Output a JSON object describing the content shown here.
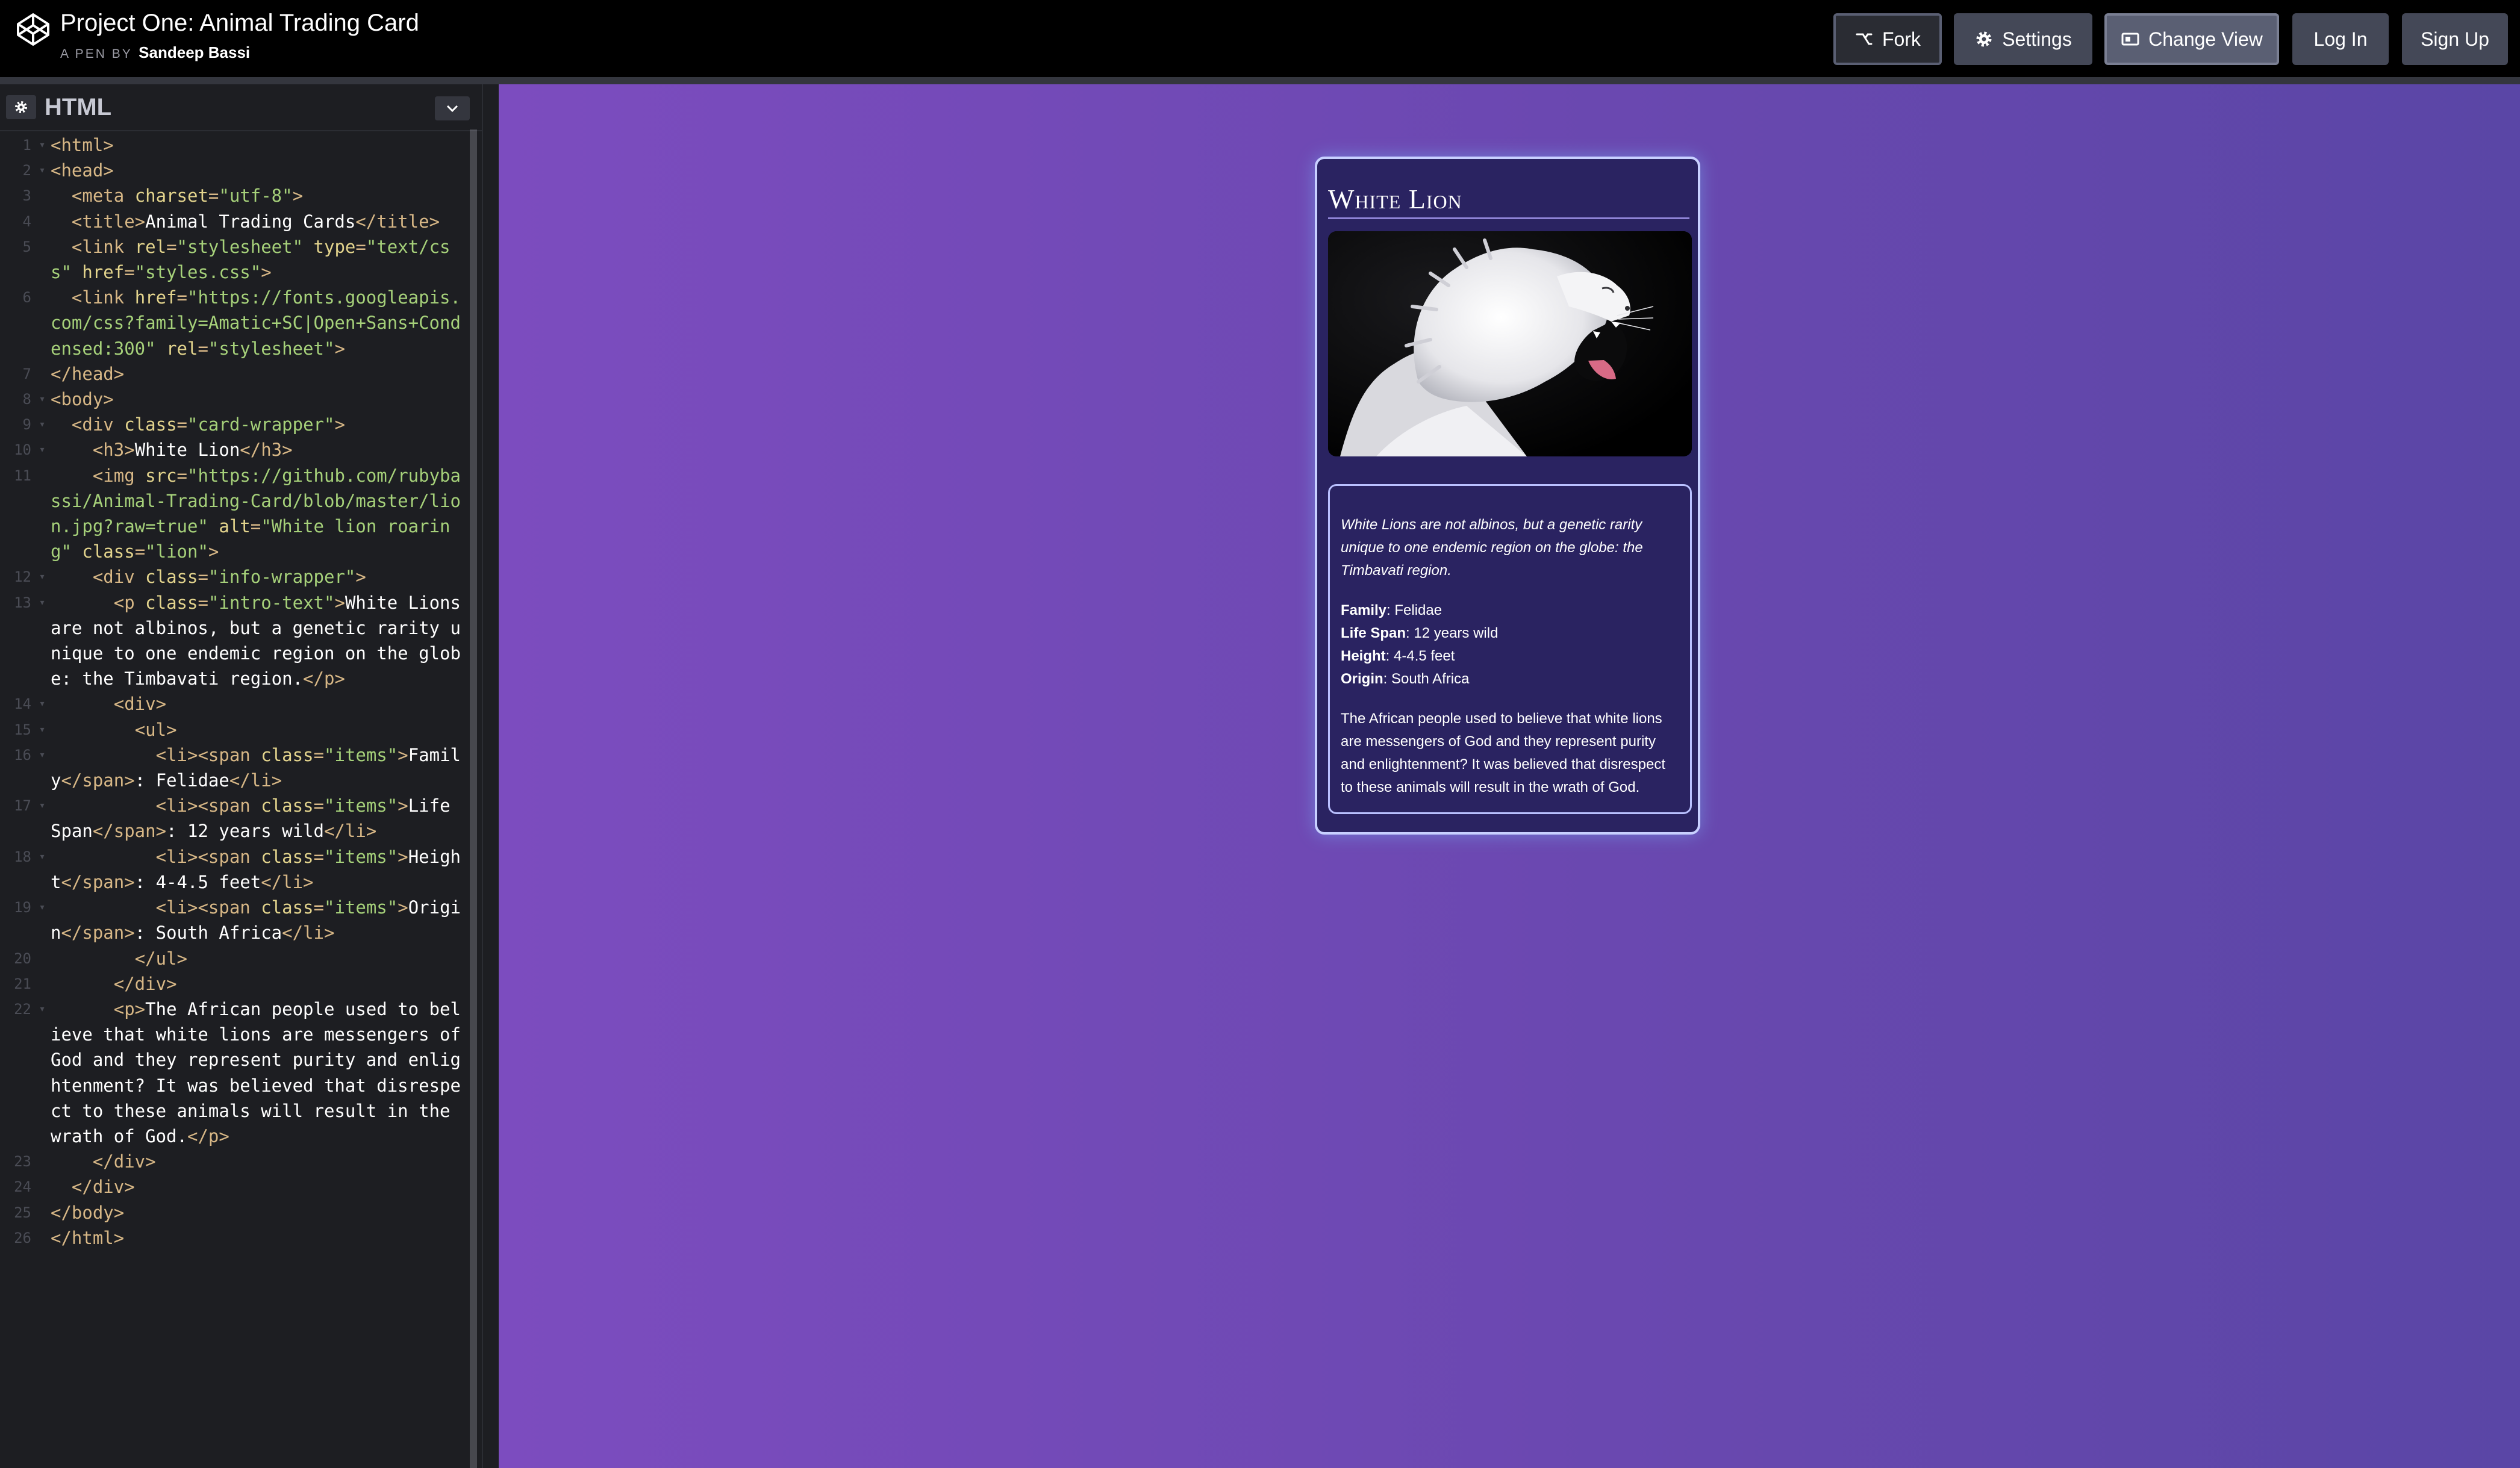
{
  "header": {
    "title": "Project One: Animal Trading Card",
    "byline_prefix": "A PEN BY",
    "author": "Sandeep Bassi",
    "buttons": {
      "fork": "Fork",
      "settings": "Settings",
      "change_view": "Change View",
      "login": "Log In",
      "signup": "Sign Up"
    },
    "icons": [
      "codepen-logo-icon",
      "fork-icon",
      "gear-icon",
      "layout-icon"
    ]
  },
  "editor": {
    "language": "HTML",
    "lines": [
      {
        "n": "1",
        "fold": true,
        "parts": [
          [
            "tag",
            "<html>"
          ]
        ]
      },
      {
        "n": "2",
        "fold": true,
        "parts": [
          [
            "tag",
            "<head>"
          ]
        ]
      },
      {
        "n": "3",
        "fold": false,
        "parts": [
          [
            "txt",
            "  "
          ],
          [
            "tag",
            "<meta "
          ],
          [
            "attr",
            "charset"
          ],
          [
            "tag",
            "="
          ],
          [
            "str",
            "\"utf-8\""
          ],
          [
            "tag",
            ">"
          ]
        ]
      },
      {
        "n": "4",
        "fold": false,
        "parts": [
          [
            "txt",
            "  "
          ],
          [
            "tag",
            "<title>"
          ],
          [
            "txt",
            "Animal Trading Cards"
          ],
          [
            "tag",
            "</title>"
          ]
        ]
      },
      {
        "n": "5",
        "fold": false,
        "parts": [
          [
            "txt",
            "  "
          ],
          [
            "tag",
            "<link "
          ],
          [
            "attr",
            "rel"
          ],
          [
            "tag",
            "="
          ],
          [
            "str",
            "\"stylesheet\""
          ],
          [
            "attr",
            " type"
          ],
          [
            "tag",
            "="
          ],
          [
            "str",
            "\"text/css\""
          ],
          [
            "attr",
            " href"
          ],
          [
            "tag",
            "="
          ],
          [
            "str",
            "\"styles.css\""
          ],
          [
            "tag",
            ">"
          ]
        ]
      },
      {
        "n": "6",
        "fold": false,
        "parts": [
          [
            "txt",
            "  "
          ],
          [
            "tag",
            "<link "
          ],
          [
            "attr",
            "href"
          ],
          [
            "tag",
            "="
          ],
          [
            "str",
            "\"https://fonts.googleapis.com/css?family=Amatic+SC|Open+Sans+Condensed:300\""
          ],
          [
            "attr",
            " rel"
          ],
          [
            "tag",
            "="
          ],
          [
            "str",
            "\"stylesheet\""
          ],
          [
            "tag",
            ">"
          ]
        ]
      },
      {
        "n": "7",
        "fold": false,
        "parts": [
          [
            "tag",
            "</head>"
          ]
        ]
      },
      {
        "n": "8",
        "fold": true,
        "parts": [
          [
            "tag",
            "<body>"
          ]
        ]
      },
      {
        "n": "9",
        "fold": true,
        "parts": [
          [
            "txt",
            "  "
          ],
          [
            "tag",
            "<div "
          ],
          [
            "attr",
            "class"
          ],
          [
            "tag",
            "="
          ],
          [
            "str",
            "\"card-wrapper\""
          ],
          [
            "tag",
            ">"
          ]
        ]
      },
      {
        "n": "10",
        "fold": true,
        "parts": [
          [
            "txt",
            "    "
          ],
          [
            "tag",
            "<h3>"
          ],
          [
            "txt",
            "White Lion"
          ],
          [
            "tag",
            "</h3>"
          ]
        ]
      },
      {
        "n": "11",
        "fold": false,
        "parts": [
          [
            "txt",
            "    "
          ],
          [
            "tag",
            "<img "
          ],
          [
            "attr",
            "src"
          ],
          [
            "tag",
            "="
          ],
          [
            "str",
            "\"https://github.com/rubybassi/Animal-Trading-Card/blob/master/lion.jpg?raw=true\""
          ],
          [
            "attr",
            " alt"
          ],
          [
            "tag",
            "="
          ],
          [
            "str",
            "\"White lion roaring\""
          ],
          [
            "attr",
            " class"
          ],
          [
            "tag",
            "="
          ],
          [
            "str",
            "\"lion\""
          ],
          [
            "tag",
            ">"
          ]
        ]
      },
      {
        "n": "12",
        "fold": true,
        "parts": [
          [
            "txt",
            "    "
          ],
          [
            "tag",
            "<div "
          ],
          [
            "attr",
            "class"
          ],
          [
            "tag",
            "="
          ],
          [
            "str",
            "\"info-wrapper\""
          ],
          [
            "tag",
            ">"
          ]
        ]
      },
      {
        "n": "13",
        "fold": true,
        "parts": [
          [
            "txt",
            "      "
          ],
          [
            "tag",
            "<p "
          ],
          [
            "attr",
            "class"
          ],
          [
            "tag",
            "="
          ],
          [
            "str",
            "\"intro-text\""
          ],
          [
            "tag",
            ">"
          ],
          [
            "txt",
            "White Lions are not albinos, but a genetic rarity unique to one endemic region on the globe: the Timbavati region."
          ],
          [
            "tag",
            "</p>"
          ]
        ]
      },
      {
        "n": "14",
        "fold": true,
        "parts": [
          [
            "txt",
            "      "
          ],
          [
            "tag",
            "<div>"
          ]
        ]
      },
      {
        "n": "15",
        "fold": true,
        "parts": [
          [
            "txt",
            "        "
          ],
          [
            "tag",
            "<ul>"
          ]
        ]
      },
      {
        "n": "16",
        "fold": true,
        "parts": [
          [
            "txt",
            "          "
          ],
          [
            "tag",
            "<li><span "
          ],
          [
            "attr",
            "class"
          ],
          [
            "tag",
            "="
          ],
          [
            "str",
            "\"items\""
          ],
          [
            "tag",
            ">"
          ],
          [
            "txt",
            "Family"
          ],
          [
            "tag",
            "</span>"
          ],
          [
            "txt",
            ": Felidae"
          ],
          [
            "tag",
            "</li>"
          ]
        ]
      },
      {
        "n": "17",
        "fold": true,
        "parts": [
          [
            "txt",
            "          "
          ],
          [
            "tag",
            "<li><span "
          ],
          [
            "attr",
            "class"
          ],
          [
            "tag",
            "="
          ],
          [
            "str",
            "\"items\""
          ],
          [
            "tag",
            ">"
          ],
          [
            "txt",
            "Life Span"
          ],
          [
            "tag",
            "</span>"
          ],
          [
            "txt",
            ": 12 years wild"
          ],
          [
            "tag",
            "</li>"
          ]
        ]
      },
      {
        "n": "18",
        "fold": true,
        "parts": [
          [
            "txt",
            "          "
          ],
          [
            "tag",
            "<li><span "
          ],
          [
            "attr",
            "class"
          ],
          [
            "tag",
            "="
          ],
          [
            "str",
            "\"items\""
          ],
          [
            "tag",
            ">"
          ],
          [
            "txt",
            "Height"
          ],
          [
            "tag",
            "</span>"
          ],
          [
            "txt",
            ": 4-4.5 feet"
          ],
          [
            "tag",
            "</li>"
          ]
        ]
      },
      {
        "n": "19",
        "fold": true,
        "parts": [
          [
            "txt",
            "          "
          ],
          [
            "tag",
            "<li><span "
          ],
          [
            "attr",
            "class"
          ],
          [
            "tag",
            "="
          ],
          [
            "str",
            "\"items\""
          ],
          [
            "tag",
            ">"
          ],
          [
            "txt",
            "Origin"
          ],
          [
            "tag",
            "</span>"
          ],
          [
            "txt",
            ": South Africa"
          ],
          [
            "tag",
            "</li>"
          ]
        ]
      },
      {
        "n": "20",
        "fold": false,
        "parts": [
          [
            "txt",
            "        "
          ],
          [
            "tag",
            "</ul>"
          ]
        ]
      },
      {
        "n": "21",
        "fold": false,
        "parts": [
          [
            "txt",
            "      "
          ],
          [
            "tag",
            "</div>"
          ]
        ]
      },
      {
        "n": "22",
        "fold": true,
        "parts": [
          [
            "txt",
            "      "
          ],
          [
            "tag",
            "<p>"
          ],
          [
            "txt",
            "The African people used to believe that white lions are messengers of God and they represent purity and enlightenment? It was believed that disrespect to these animals will result in the wrath of God."
          ],
          [
            "tag",
            "</p>"
          ]
        ]
      },
      {
        "n": "23",
        "fold": false,
        "parts": [
          [
            "txt",
            "    "
          ],
          [
            "tag",
            "</div>"
          ]
        ]
      },
      {
        "n": "24",
        "fold": false,
        "parts": [
          [
            "txt",
            "  "
          ],
          [
            "tag",
            "</div>"
          ]
        ]
      },
      {
        "n": "25",
        "fold": false,
        "parts": [
          [
            "tag",
            "</body>"
          ]
        ]
      },
      {
        "n": "26",
        "fold": false,
        "parts": [
          [
            "tag",
            "</html>"
          ]
        ]
      }
    ]
  },
  "card": {
    "title": "White Lion",
    "image_alt": "White lion roaring",
    "intro": "White Lions are not albinos, but a genetic rarity unique to one endemic region on the globe: the Timbavati region.",
    "facts": [
      {
        "label": "Family",
        "value": ": Felidae"
      },
      {
        "label": "Life Span",
        "value": ": 12 years wild"
      },
      {
        "label": "Height",
        "value": ": 4-4.5 feet"
      },
      {
        "label": "Origin",
        "value": ": South Africa"
      }
    ],
    "description": "The African people used to believe that white lions are messengers of God and they represent purity and enlightenment? It was believed that disrespect to these animals will result in the wrath of God."
  },
  "colors": {
    "topbar": "#000000",
    "editor_bg": "#1d1e22",
    "preview_gradient_start": "#7c4cbf",
    "preview_gradient_end": "#5a46a6",
    "card_bg": "#2a2361",
    "card_glow": "#78beff"
  }
}
